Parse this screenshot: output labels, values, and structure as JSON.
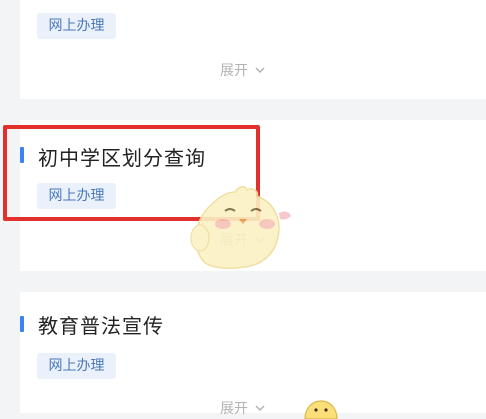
{
  "cards": [
    {
      "tag": "网上办理",
      "expand": "展开"
    },
    {
      "title": "初中学区划分查询",
      "tag": "网上办理",
      "expand": "展开"
    },
    {
      "title": "教育普法宣传",
      "tag": "网上办理",
      "expand": "展开"
    }
  ],
  "colors": {
    "accent": "#3b82f6",
    "tag_bg": "#eaf1fb",
    "tag_text": "#4a78b8",
    "highlight": "#e2302d"
  },
  "icons": {
    "expand": "chevron-down-icon",
    "mascot": "chick-mascot"
  }
}
